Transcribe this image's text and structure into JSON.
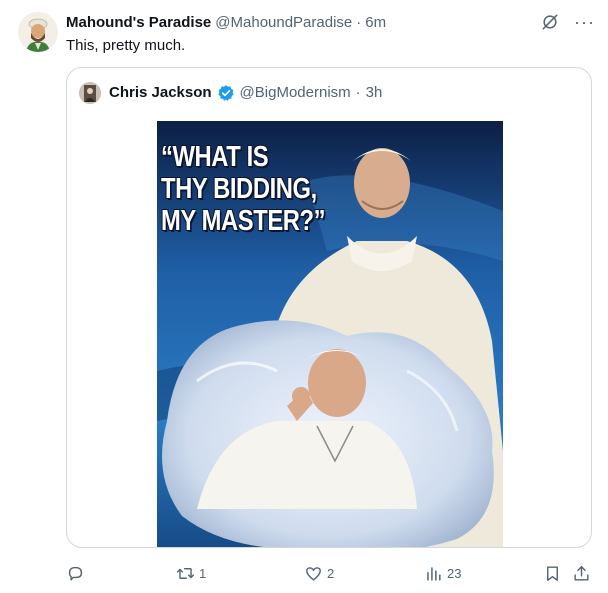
{
  "tweet": {
    "author": {
      "display_name": "Mahound's Paradise",
      "handle": "@MahoundParadise",
      "separator": "·",
      "time": "6m"
    },
    "text": "This, pretty much.",
    "top_icons": [
      "grok-icon",
      "more-icon"
    ],
    "more_label": "···"
  },
  "quote": {
    "author": {
      "display_name": "Chris Jackson",
      "verified": true,
      "handle": "@BigModernism",
      "separator": "·",
      "time": "3h"
    },
    "meme_caption": "“WHAT IS\nTHY BIDDING,\nMY MASTER?”"
  },
  "actions": {
    "reply_count": "",
    "retweet_count": "1",
    "like_count": "2",
    "views_count": "23"
  },
  "colors": {
    "text_primary": "#0f1419",
    "text_secondary": "#536471",
    "border": "#cfd9de",
    "verified_blue": "#1d9bf0"
  }
}
